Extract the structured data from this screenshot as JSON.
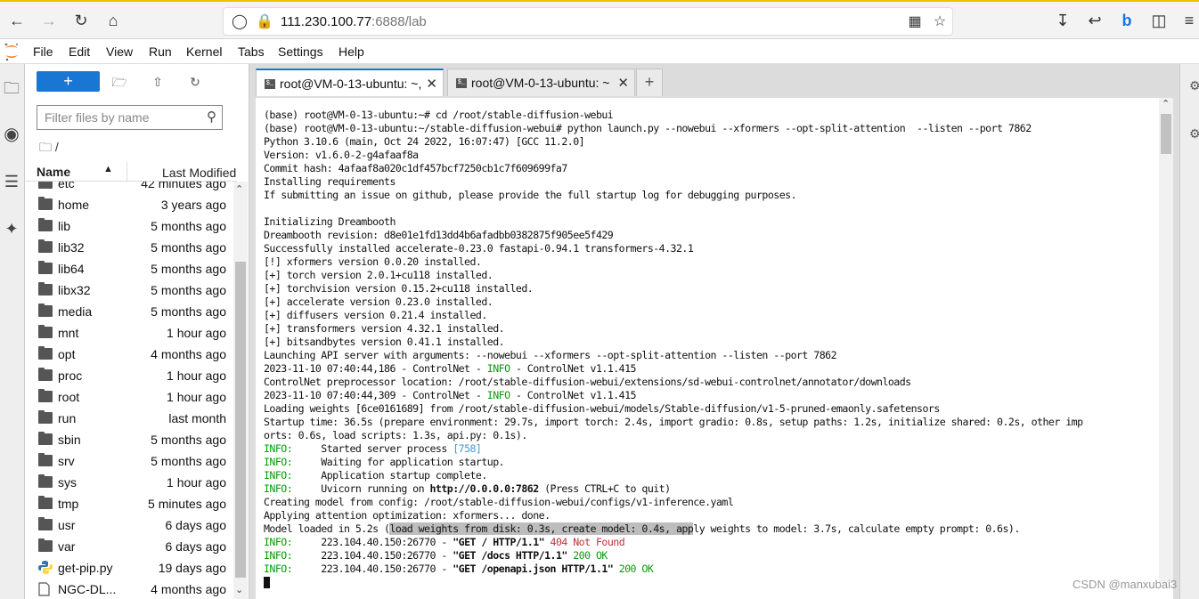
{
  "browser": {
    "url_host": "111.230.100.77",
    "url_port_path": ":6888/lab"
  },
  "menu": [
    "File",
    "Edit",
    "View",
    "Run",
    "Kernel",
    "Tabs",
    "Settings",
    "Help"
  ],
  "filebrowser": {
    "new_label": "+",
    "filter_placeholder": "Filter files by name",
    "breadcrumb": "/",
    "col_name": "Name",
    "col_modified": "Last Modified",
    "files": [
      {
        "name": "etc",
        "modified": "42 minutes ago",
        "type": "folder"
      },
      {
        "name": "home",
        "modified": "3 years ago",
        "type": "folder"
      },
      {
        "name": "lib",
        "modified": "5 months ago",
        "type": "folder"
      },
      {
        "name": "lib32",
        "modified": "5 months ago",
        "type": "folder"
      },
      {
        "name": "lib64",
        "modified": "5 months ago",
        "type": "folder"
      },
      {
        "name": "libx32",
        "modified": "5 months ago",
        "type": "folder"
      },
      {
        "name": "media",
        "modified": "5 months ago",
        "type": "folder"
      },
      {
        "name": "mnt",
        "modified": "1 hour ago",
        "type": "folder"
      },
      {
        "name": "opt",
        "modified": "4 months ago",
        "type": "folder"
      },
      {
        "name": "proc",
        "modified": "1 hour ago",
        "type": "folder"
      },
      {
        "name": "root",
        "modified": "1 hour ago",
        "type": "folder"
      },
      {
        "name": "run",
        "modified": "last month",
        "type": "folder"
      },
      {
        "name": "sbin",
        "modified": "5 months ago",
        "type": "folder"
      },
      {
        "name": "srv",
        "modified": "5 months ago",
        "type": "folder"
      },
      {
        "name": "sys",
        "modified": "1 hour ago",
        "type": "folder"
      },
      {
        "name": "tmp",
        "modified": "5 minutes ago",
        "type": "folder"
      },
      {
        "name": "usr",
        "modified": "6 days ago",
        "type": "folder"
      },
      {
        "name": "var",
        "modified": "6 days ago",
        "type": "folder"
      },
      {
        "name": "get-pip.py",
        "modified": "19 days ago",
        "type": "python"
      },
      {
        "name": "NGC-DL...",
        "modified": "4 months ago",
        "type": "file"
      }
    ]
  },
  "tabs": [
    {
      "label": "root@VM-0-13-ubuntu: ~,"
    },
    {
      "label": "root@VM-0-13-ubuntu: ~"
    }
  ],
  "terminal": {
    "lines": [
      "(base) root@VM-0-13-ubuntu:~# cd /root/stable-diffusion-webui",
      "(base) root@VM-0-13-ubuntu:~/stable-diffusion-webui# python launch.py --nowebui --xformers --opt-split-attention  --listen --port 7862",
      "Python 3.10.6 (main, Oct 24 2022, 16:07:47) [GCC 11.2.0]",
      "Version: v1.6.0-2-g4afaaf8a",
      "Commit hash: 4afaaf8a020c1df457bcf7250cb1c7f609699fa7",
      "Installing requirements",
      "If submitting an issue on github, please provide the full startup log for debugging purposes.",
      "",
      "Initializing Dreambooth",
      "Dreambooth revision: d8e01e1fd13dd4b6afadbb0382875f905ee5f429",
      "Successfully installed accelerate-0.23.0 fastapi-0.94.1 transformers-4.32.1",
      "[!] xformers version 0.0.20 installed.",
      "[+] torch version 2.0.1+cu118 installed.",
      "[+] torchvision version 0.15.2+cu118 installed.",
      "[+] accelerate version 0.23.0 installed.",
      "[+] diffusers version 0.21.4 installed.",
      "[+] transformers version 4.32.1 installed.",
      "[+] bitsandbytes version 0.41.1 installed.",
      "Launching API server with arguments: --nowebui --xformers --opt-split-attention --listen --port 7862",
      "2023-11-10 07:40:44,186 - ControlNet - INFO - ControlNet v1.1.415",
      "ControlNet preprocessor location: /root/stable-diffusion-webui/extensions/sd-webui-controlnet/annotator/downloads",
      "2023-11-10 07:40:44,309 - ControlNet - INFO - ControlNet v1.1.415",
      "Loading weights [6ce0161689] from /root/stable-diffusion-webui/models/Stable-diffusion/v1-5-pruned-emaonly.safetensors",
      "Startup time: 36.5s (prepare environment: 29.7s, import torch: 2.4s, import gradio: 0.8s, setup paths: 1.2s, initialize shared: 0.2s, other imp",
      "orts: 0.6s, load scripts: 1.3s, api.py: 0.1s).",
      "INFO:     Started server process [758]",
      "INFO:     Waiting for application startup.",
      "INFO:     Application startup complete.",
      "INFO:     Uvicorn running on http://0.0.0.0:7862 (Press CTRL+C to quit)",
      "Creating model from config: /root/stable-diffusion-webui/configs/v1-inference.yaml",
      "Applying attention optimization: xformers... done.",
      "Model loaded in 5.2s (load weights from disk: 0.3s, create model: 0.4s, apply weights to model: 3.7s, calculate empty prompt: 0.6s).",
      "INFO:     223.104.40.150:26770 - \"GET / HTTP/1.1\" 404 Not Found",
      "INFO:     223.104.40.150:26770 - \"GET /docs HTTP/1.1\" 200 OK",
      "INFO:     223.104.40.150:26770 - \"GET /openapi.json HTTP/1.1\" 200 OK"
    ]
  },
  "watermark": "CSDN @manxubai3"
}
